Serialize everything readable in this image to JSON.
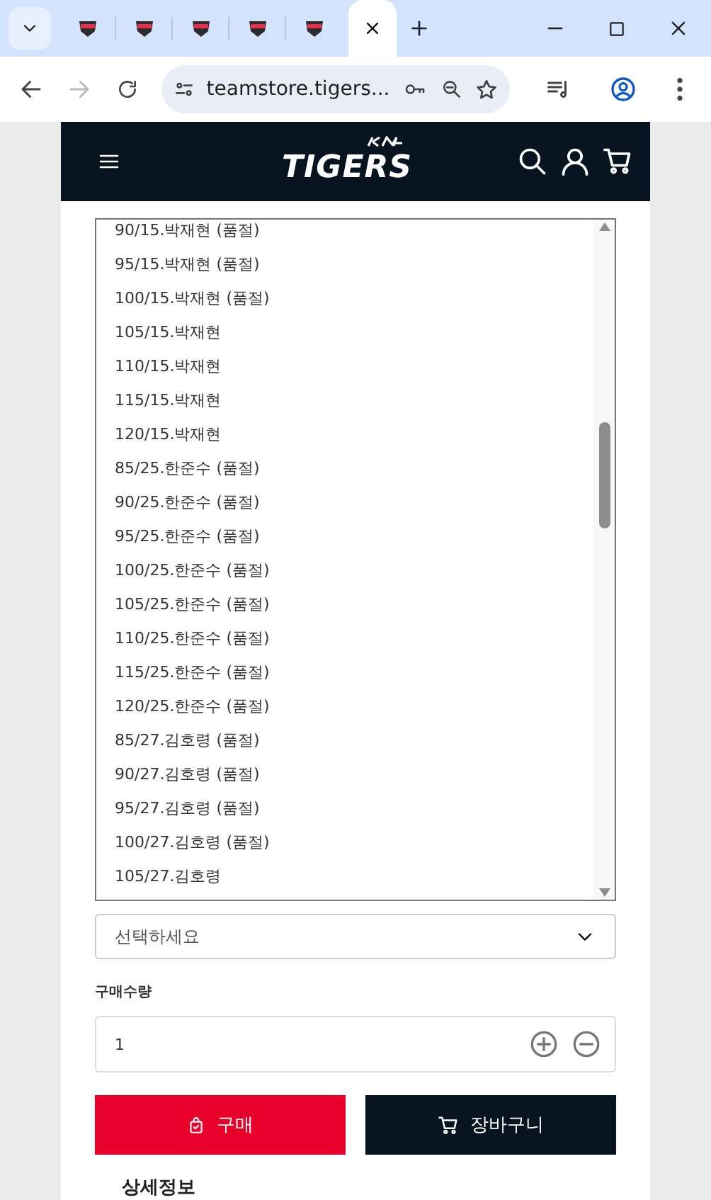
{
  "browser": {
    "tabs": [
      {
        "kind": "favicon",
        "selected": false
      },
      {
        "kind": "favicon",
        "selected": false
      },
      {
        "kind": "favicon",
        "selected": false
      },
      {
        "kind": "favicon",
        "selected": false
      },
      {
        "kind": "favicon",
        "selected": false
      },
      {
        "kind": "close",
        "selected": true
      }
    ],
    "address": "teamstore.tigers..."
  },
  "header": {
    "brand": "TIGERS"
  },
  "option_list": {
    "items": [
      {
        "label": "90/15.박재현 (품절)"
      },
      {
        "label": "95/15.박재현 (품절)"
      },
      {
        "label": "100/15.박재현 (품절)"
      },
      {
        "label": "105/15.박재현"
      },
      {
        "label": "110/15.박재현"
      },
      {
        "label": "115/15.박재현"
      },
      {
        "label": "120/15.박재현"
      },
      {
        "label": "85/25.한준수 (품절)"
      },
      {
        "label": "90/25.한준수 (품절)"
      },
      {
        "label": "95/25.한준수 (품절)"
      },
      {
        "label": "100/25.한준수 (품절)"
      },
      {
        "label": "105/25.한준수 (품절)"
      },
      {
        "label": "110/25.한준수 (품절)"
      },
      {
        "label": "115/25.한준수 (품절)"
      },
      {
        "label": "120/25.한준수 (품절)"
      },
      {
        "label": "85/27.김호령 (품절)"
      },
      {
        "label": "90/27.김호령 (품절)"
      },
      {
        "label": "95/27.김호령 (품절)"
      },
      {
        "label": "100/27.김호령 (품절)"
      },
      {
        "label": "105/27.김호령"
      }
    ]
  },
  "select": {
    "placeholder": "선택하세요"
  },
  "quantity": {
    "label": "구매수량",
    "value": "1"
  },
  "buttons": [
    {
      "kind": "buy",
      "label": "구매"
    },
    {
      "kind": "cart",
      "label": "장바구니"
    }
  ],
  "detail_tab": "상세정보"
}
